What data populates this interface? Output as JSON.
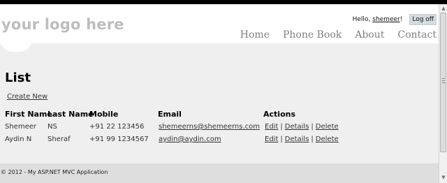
{
  "header": {
    "logo_text": "your logo here",
    "login": {
      "hello": "Hello,",
      "username": "shemeer",
      "exclaim": "!",
      "logoff_label": "Log off"
    },
    "nav": [
      "Home",
      "Phone Book",
      "About",
      "Contact"
    ]
  },
  "main": {
    "title": "List",
    "create_new": "Create New",
    "table": {
      "headers": {
        "first": "First Name",
        "last": "Last Name",
        "mobile": "Mobile",
        "email": "Email",
        "actions": "Actions"
      },
      "rows": [
        {
          "first": "Shemeer",
          "last": "NS",
          "mobile": "+91 22 123456",
          "email": "shemeerns@shemeerns.com"
        },
        {
          "first": "Aydin N",
          "last": "Sheraf",
          "mobile": "+91 99 1234567",
          "email": "aydin@aydin.com"
        }
      ],
      "actions": {
        "edit": "Edit",
        "details": "Details",
        "delete": "Delete",
        "separator": "|"
      }
    }
  },
  "footer": {
    "text": "© 2012 - My ASP.NET MVC Application"
  },
  "scrollbar": {
    "up_icon": "▲",
    "down_icon": "▼"
  }
}
